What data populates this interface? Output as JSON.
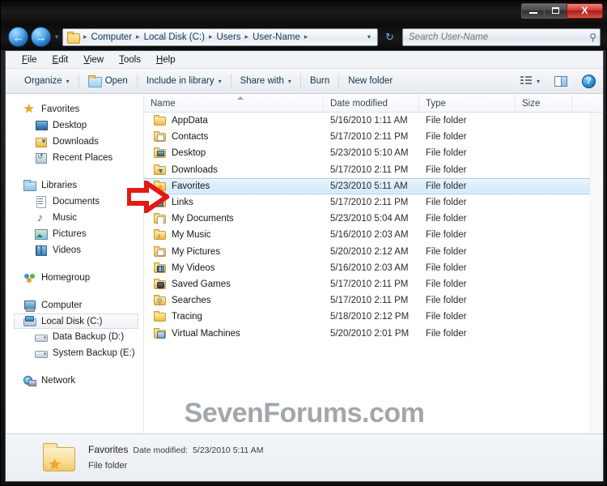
{
  "window": {
    "controls": {
      "minimize": "Minimize",
      "maximize": "Maximize",
      "close": "X"
    }
  },
  "address_bar": {
    "back_glyph": "←",
    "forward_glyph": "→",
    "recent_caret": "▾",
    "crumbs": [
      "Computer",
      "Local Disk (C:)",
      "Users",
      "User-Name"
    ],
    "separator": "▸",
    "dropdown_caret": "▾",
    "refresh_glyph": "↻",
    "search_placeholder": "Search User-Name",
    "search_value": "",
    "search_icon": "⚲"
  },
  "menubar": {
    "items": [
      {
        "pre": "F",
        "post": "ile"
      },
      {
        "pre": "E",
        "post": "dit"
      },
      {
        "pre": "V",
        "post": "iew"
      },
      {
        "pre": "T",
        "post": "ools"
      },
      {
        "pre": "H",
        "post": "elp"
      }
    ]
  },
  "toolbar": {
    "organize": "Organize",
    "open": "Open",
    "include_in_library": "Include in library",
    "share_with": "Share with",
    "burn": "Burn",
    "new_folder": "New folder",
    "caret": "▾",
    "help_glyph": "?"
  },
  "navigation_pane": {
    "groups": [
      {
        "header": {
          "label": "Favorites",
          "icon": "star-icon"
        },
        "children": [
          {
            "label": "Desktop",
            "icon": "desktop-icon"
          },
          {
            "label": "Downloads",
            "icon": "downloads-icon"
          },
          {
            "label": "Recent Places",
            "icon": "recent-places-icon"
          }
        ]
      },
      {
        "header": {
          "label": "Libraries",
          "icon": "libraries-icon"
        },
        "children": [
          {
            "label": "Documents",
            "icon": "documents-icon"
          },
          {
            "label": "Music",
            "icon": "music-icon"
          },
          {
            "label": "Pictures",
            "icon": "pictures-icon"
          },
          {
            "label": "Videos",
            "icon": "videos-icon"
          }
        ]
      },
      {
        "header": {
          "label": "Homegroup",
          "icon": "homegroup-icon"
        },
        "children": []
      },
      {
        "header": {
          "label": "Computer",
          "icon": "computer-icon"
        },
        "children": [
          {
            "label": "Local Disk (C:)",
            "icon": "local-disk-icon",
            "selected": true
          },
          {
            "label": "Data Backup (D:)",
            "icon": "drive-icon"
          },
          {
            "label": "System Backup (E:)",
            "icon": "drive-icon"
          }
        ]
      },
      {
        "header": {
          "label": "Network",
          "icon": "network-icon"
        },
        "children": []
      }
    ]
  },
  "file_list": {
    "columns": [
      {
        "key": "name",
        "label": "Name",
        "sorted": true,
        "sort_dir": "asc"
      },
      {
        "key": "date",
        "label": "Date modified"
      },
      {
        "key": "type",
        "label": "Type"
      },
      {
        "key": "size",
        "label": "Size"
      }
    ],
    "rows": [
      {
        "name": "AppData",
        "date": "5/16/2010 1:11 AM",
        "type": "File folder",
        "size": "",
        "icon": "folder-plain-icon",
        "selected": false
      },
      {
        "name": "Contacts",
        "date": "5/17/2010 2:11 PM",
        "type": "File folder",
        "size": "",
        "icon": "folder-contacts-icon",
        "selected": false
      },
      {
        "name": "Desktop",
        "date": "5/23/2010 5:10 AM",
        "type": "File folder",
        "size": "",
        "icon": "folder-desktop-icon",
        "selected": false
      },
      {
        "name": "Downloads",
        "date": "5/17/2010 2:11 PM",
        "type": "File folder",
        "size": "",
        "icon": "folder-downloads-icon",
        "selected": false
      },
      {
        "name": "Favorites",
        "date": "5/23/2010 5:11 AM",
        "type": "File folder",
        "size": "",
        "icon": "folder-favorites-icon",
        "selected": true
      },
      {
        "name": "Links",
        "date": "5/17/2010 2:11 PM",
        "type": "File folder",
        "size": "",
        "icon": "folder-links-icon",
        "selected": false
      },
      {
        "name": "My Documents",
        "date": "5/23/2010 5:04 AM",
        "type": "File folder",
        "size": "",
        "icon": "folder-documents-icon",
        "selected": false
      },
      {
        "name": "My Music",
        "date": "5/16/2010 2:03 AM",
        "type": "File folder",
        "size": "",
        "icon": "folder-music-icon",
        "selected": false
      },
      {
        "name": "My Pictures",
        "date": "5/20/2010 2:12 AM",
        "type": "File folder",
        "size": "",
        "icon": "folder-pictures-icon",
        "selected": false
      },
      {
        "name": "My Videos",
        "date": "5/16/2010 2:03 AM",
        "type": "File folder",
        "size": "",
        "icon": "folder-videos-icon",
        "selected": false
      },
      {
        "name": "Saved Games",
        "date": "5/17/2010 2:11 PM",
        "type": "File folder",
        "size": "",
        "icon": "folder-saved-games-icon",
        "selected": false
      },
      {
        "name": "Searches",
        "date": "5/17/2010 2:11 PM",
        "type": "File folder",
        "size": "",
        "icon": "folder-searches-icon",
        "selected": false
      },
      {
        "name": "Tracing",
        "date": "5/18/2010 2:12 PM",
        "type": "File folder",
        "size": "",
        "icon": "folder-plain-icon",
        "selected": false
      },
      {
        "name": "Virtual Machines",
        "date": "5/20/2010 2:01 PM",
        "type": "File folder",
        "size": "",
        "icon": "folder-vm-icon",
        "selected": false
      }
    ]
  },
  "annotation": {
    "red_arrow": {
      "target_row": "Favorites",
      "color": "#E01B16",
      "direction": "right"
    }
  },
  "watermark": {
    "text": "SevenForums.com",
    "color": "#9AA0A6"
  },
  "details_pane": {
    "name": "Favorites",
    "date_label": "Date modified:",
    "date_value": "5/23/2010 5:11 AM",
    "type": "File folder"
  },
  "colors": {
    "selection_blue": "#CFE6F8",
    "folder_gold": "#F6C75A",
    "accent_blue": "#2F6EA8",
    "annotation_red": "#E01B16",
    "frame_black": "#101010"
  }
}
